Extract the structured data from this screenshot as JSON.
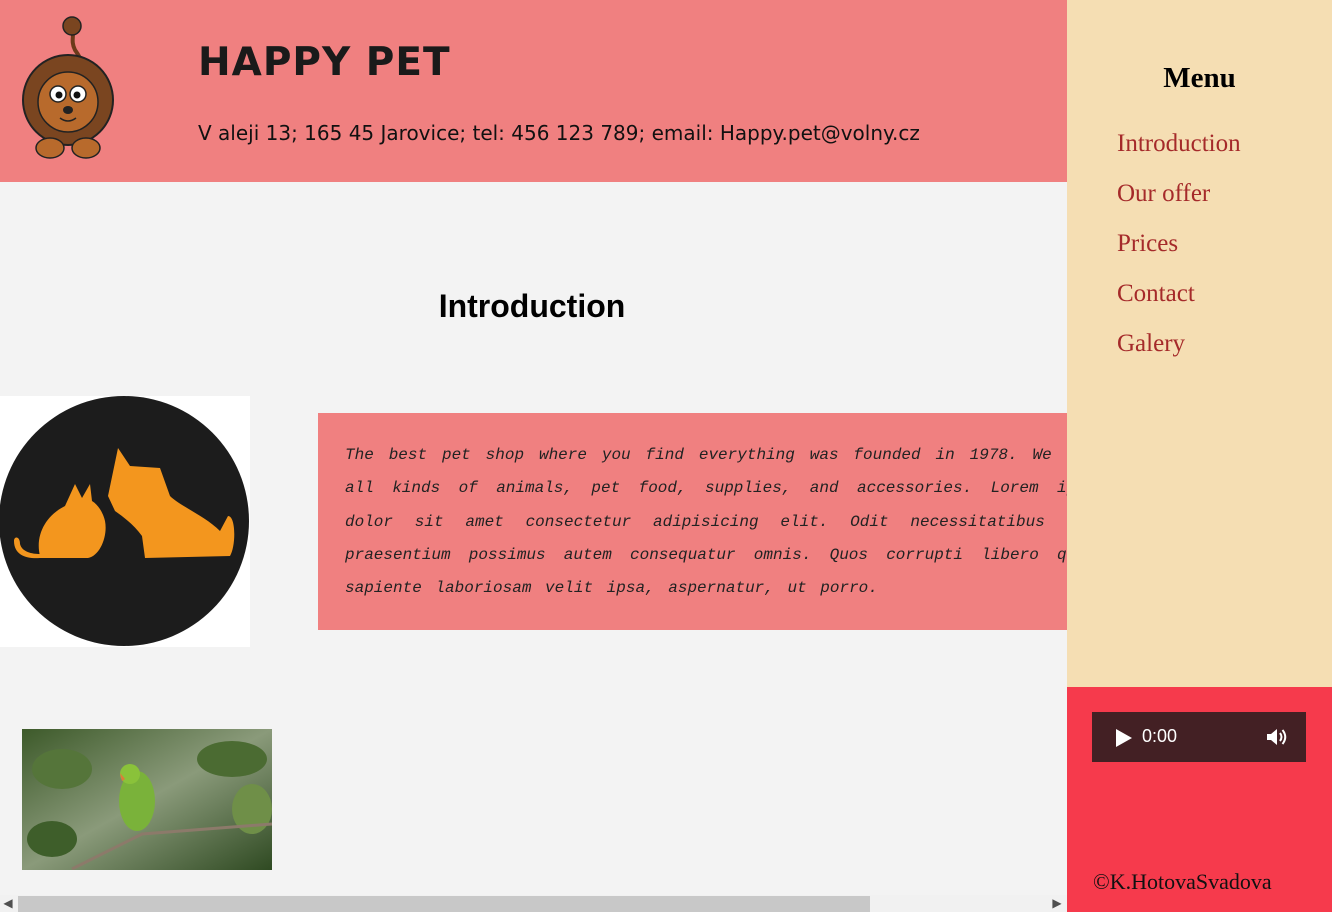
{
  "header": {
    "title": "HAPPY PET",
    "address": "V aleji 13; 165 45 Jarovice; tel: 456 123 789; email: Happy.pet@volny.cz"
  },
  "main": {
    "heading": "Introduction",
    "intro_text": "The best pet shop where you find everything was founded in 1978. We have all kinds of animals, pet food, supplies, and accessories. Lorem ipsum dolor sit amet consectetur adipisicing elit. Odit necessitatibus odio praesentium possimus autem consequatur omnis. Quos corrupti libero quasi sapiente laboriosam velit ipsa, aspernatur, ut porro."
  },
  "sidebar": {
    "menu_title": "Menu",
    "items": [
      {
        "label": "Introduction"
      },
      {
        "label": "Our offer"
      },
      {
        "label": "Prices"
      },
      {
        "label": "Contact"
      },
      {
        "label": "Galery"
      }
    ]
  },
  "audio": {
    "time": "0:00",
    "icons": [
      "play-icon",
      "volume-icon"
    ]
  },
  "footer": {
    "copyright": "©K.HotovaSvadova"
  },
  "colors": {
    "header_bg": "#f08080",
    "sidebar_bg": "#f5deb3",
    "footer_bg": "#f63a4c",
    "link": "#a52a2a",
    "page_bg": "#f3f3f3"
  }
}
